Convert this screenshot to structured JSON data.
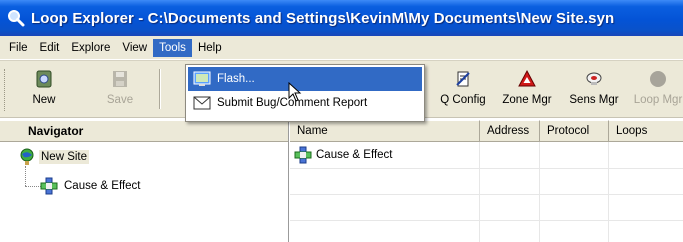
{
  "window": {
    "title": "Loop Explorer - C:\\Documents and Settings\\KevinM\\My Documents\\New Site.syn",
    "icon": "magnifier-icon"
  },
  "menubar": {
    "items": [
      {
        "label": "File"
      },
      {
        "label": "Edit"
      },
      {
        "label": "Explore"
      },
      {
        "label": "View"
      },
      {
        "label": "Tools",
        "active": true
      },
      {
        "label": "Help"
      }
    ]
  },
  "toolbar": {
    "buttons": [
      {
        "label": "New",
        "icon": "new-site-icon",
        "enabled": true
      },
      {
        "label": "Save",
        "icon": "floppy-disk-icon",
        "enabled": false
      },
      {
        "label": "Q Config",
        "icon": "config-icon",
        "enabled": true
      },
      {
        "label": "Zone Mgr",
        "icon": "zone-triangle-icon",
        "enabled": true
      },
      {
        "label": "Sens Mgr",
        "icon": "sensor-icon",
        "enabled": true
      },
      {
        "label": "Loop Mgr",
        "icon": "loop-circle-icon",
        "enabled": false
      }
    ]
  },
  "tools_menu": {
    "items": [
      {
        "label": "Flash...",
        "icon": "flash-icon",
        "highlighted": true
      },
      {
        "label": "Submit Bug/Comment Report",
        "icon": "envelope-icon",
        "highlighted": false
      }
    ]
  },
  "navigator": {
    "header": "Navigator",
    "tree": [
      {
        "label": "New Site",
        "icon": "globe-icon",
        "level": 0,
        "selected": true
      },
      {
        "label": "Cause & Effect",
        "icon": "cause-effect-icon",
        "level": 1,
        "selected": false
      }
    ]
  },
  "listview": {
    "columns": [
      "Name",
      "Address",
      "Protocol",
      "Loops"
    ],
    "rows": [
      {
        "name": "Cause & Effect",
        "address": "",
        "protocol": "",
        "loops": "",
        "icon": "cause-effect-icon"
      }
    ]
  },
  "colors": {
    "titlebar": "#0453d6",
    "menu_highlight": "#316ac5",
    "face": "#ece9d8"
  }
}
